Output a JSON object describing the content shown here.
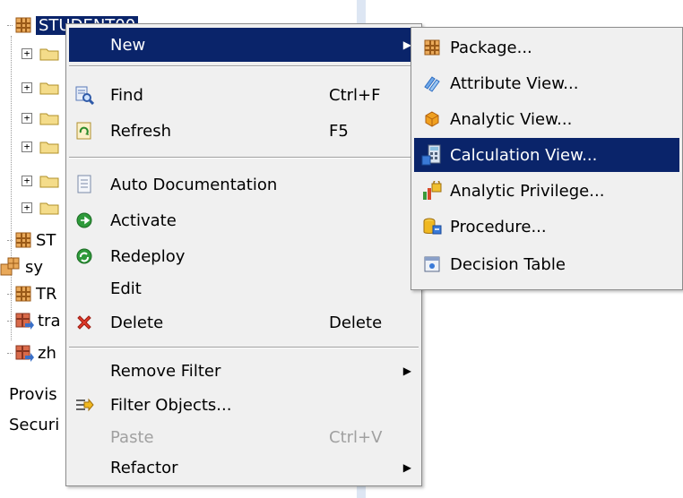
{
  "tree": {
    "selected_label": "STUDENT00",
    "items": [
      "ST",
      "sy",
      "TR",
      "tra",
      "zh",
      "Provis",
      "Securi"
    ]
  },
  "context_menu": {
    "new": {
      "label": "New",
      "icon": "none"
    },
    "find": {
      "label": "Find",
      "shortcut": "Ctrl+F",
      "icon": "find-icon"
    },
    "refresh": {
      "label": "Refresh",
      "shortcut": "F5",
      "icon": "refresh-icon"
    },
    "auto_doc": {
      "label": "Auto Documentation",
      "icon": "document-icon"
    },
    "activate": {
      "label": "Activate",
      "icon": "activate-icon"
    },
    "redeploy": {
      "label": "Redeploy",
      "icon": "redeploy-icon"
    },
    "edit": {
      "label": "Edit"
    },
    "delete": {
      "label": "Delete",
      "shortcut": "Delete",
      "icon": "delete-icon"
    },
    "remove_filter": {
      "label": "Remove Filter"
    },
    "filter_objects": {
      "label": "Filter Objects...",
      "icon": "filter-icon"
    },
    "paste": {
      "label": "Paste",
      "shortcut": "Ctrl+V",
      "disabled": true
    },
    "refactor": {
      "label": "Refactor"
    }
  },
  "submenu": {
    "package": {
      "label": "Package...",
      "icon": "package-icon"
    },
    "attribute_view": {
      "label": "Attribute View...",
      "icon": "attribute-view-icon"
    },
    "analytic_view": {
      "label": "Analytic View...",
      "icon": "analytic-view-icon"
    },
    "calculation_view": {
      "label": "Calculation View...",
      "icon": "calculation-view-icon",
      "highlighted": true
    },
    "analytic_privilege": {
      "label": "Analytic Privilege...",
      "icon": "analytic-privilege-icon"
    },
    "procedure": {
      "label": "Procedure...",
      "icon": "procedure-icon"
    },
    "decision_table": {
      "label": "Decision Table",
      "icon": "decision-table-icon"
    }
  },
  "colors": {
    "highlight": "#0a246a",
    "menu_bg": "#f0f0f0",
    "package": "#c8822a"
  }
}
